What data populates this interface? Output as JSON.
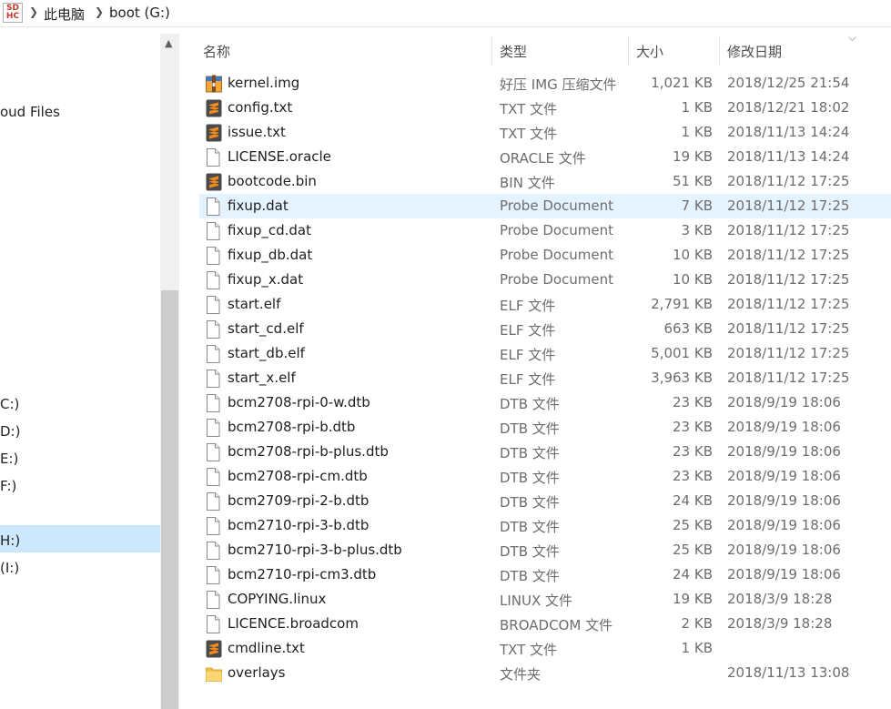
{
  "address_bar": {
    "drive_icon_text_top": "SD",
    "drive_icon_text_bottom": "HC",
    "crumbs": [
      "此电脑",
      "boot (G:)"
    ]
  },
  "nav": {
    "items": [
      "oud Files",
      "C:)",
      "D:)",
      "E:)",
      "F:)",
      "H:)",
      "(I:)"
    ]
  },
  "columns": {
    "name": "名称",
    "type": "类型",
    "size": "大小",
    "date": "修改日期"
  },
  "files": [
    {
      "name": "kernel.img",
      "type": "好压 IMG 压缩文件",
      "size": "1,021 KB",
      "date": "2018/12/25 21:54",
      "icon": "archive-icon"
    },
    {
      "name": "config.txt",
      "type": "TXT 文件",
      "size": "1 KB",
      "date": "2018/12/21 18:02",
      "icon": "sublime-icon"
    },
    {
      "name": "issue.txt",
      "type": "TXT 文件",
      "size": "1 KB",
      "date": "2018/11/13 14:24",
      "icon": "sublime-icon"
    },
    {
      "name": "LICENSE.oracle",
      "type": "ORACLE 文件",
      "size": "19 KB",
      "date": "2018/11/13 14:24",
      "icon": "file-icon"
    },
    {
      "name": "bootcode.bin",
      "type": "BIN 文件",
      "size": "51 KB",
      "date": "2018/11/12 17:25",
      "icon": "sublime-icon"
    },
    {
      "name": "fixup.dat",
      "type": "Probe Document",
      "size": "7 KB",
      "date": "2018/11/12 17:25",
      "icon": "file-icon"
    },
    {
      "name": "fixup_cd.dat",
      "type": "Probe Document",
      "size": "3 KB",
      "date": "2018/11/12 17:25",
      "icon": "file-icon"
    },
    {
      "name": "fixup_db.dat",
      "type": "Probe Document",
      "size": "10 KB",
      "date": "2018/11/12 17:25",
      "icon": "file-icon"
    },
    {
      "name": "fixup_x.dat",
      "type": "Probe Document",
      "size": "10 KB",
      "date": "2018/11/12 17:25",
      "icon": "file-icon"
    },
    {
      "name": "start.elf",
      "type": "ELF 文件",
      "size": "2,791 KB",
      "date": "2018/11/12 17:25",
      "icon": "file-icon"
    },
    {
      "name": "start_cd.elf",
      "type": "ELF 文件",
      "size": "663 KB",
      "date": "2018/11/12 17:25",
      "icon": "file-icon"
    },
    {
      "name": "start_db.elf",
      "type": "ELF 文件",
      "size": "5,001 KB",
      "date": "2018/11/12 17:25",
      "icon": "file-icon"
    },
    {
      "name": "start_x.elf",
      "type": "ELF 文件",
      "size": "3,963 KB",
      "date": "2018/11/12 17:25",
      "icon": "file-icon"
    },
    {
      "name": "bcm2708-rpi-0-w.dtb",
      "type": "DTB 文件",
      "size": "23 KB",
      "date": "2018/9/19 18:06",
      "icon": "file-icon"
    },
    {
      "name": "bcm2708-rpi-b.dtb",
      "type": "DTB 文件",
      "size": "23 KB",
      "date": "2018/9/19 18:06",
      "icon": "file-icon"
    },
    {
      "name": "bcm2708-rpi-b-plus.dtb",
      "type": "DTB 文件",
      "size": "23 KB",
      "date": "2018/9/19 18:06",
      "icon": "file-icon"
    },
    {
      "name": "bcm2708-rpi-cm.dtb",
      "type": "DTB 文件",
      "size": "23 KB",
      "date": "2018/9/19 18:06",
      "icon": "file-icon"
    },
    {
      "name": "bcm2709-rpi-2-b.dtb",
      "type": "DTB 文件",
      "size": "24 KB",
      "date": "2018/9/19 18:06",
      "icon": "file-icon"
    },
    {
      "name": "bcm2710-rpi-3-b.dtb",
      "type": "DTB 文件",
      "size": "25 KB",
      "date": "2018/9/19 18:06",
      "icon": "file-icon"
    },
    {
      "name": "bcm2710-rpi-3-b-plus.dtb",
      "type": "DTB 文件",
      "size": "25 KB",
      "date": "2018/9/19 18:06",
      "icon": "file-icon"
    },
    {
      "name": "bcm2710-rpi-cm3.dtb",
      "type": "DTB 文件",
      "size": "24 KB",
      "date": "2018/9/19 18:06",
      "icon": "file-icon"
    },
    {
      "name": "COPYING.linux",
      "type": "LINUX 文件",
      "size": "19 KB",
      "date": "2018/3/9 18:28",
      "icon": "file-icon"
    },
    {
      "name": "LICENCE.broadcom",
      "type": "BROADCOM 文件",
      "size": "2 KB",
      "date": "2018/3/9 18:28",
      "icon": "file-icon"
    },
    {
      "name": "cmdline.txt",
      "type": "TXT 文件",
      "size": "1 KB",
      "date": "",
      "icon": "sublime-icon"
    },
    {
      "name": "overlays",
      "type": "文件夹",
      "size": "",
      "date": "2018/11/13 13:08",
      "icon": "folder-icon"
    }
  ],
  "hovered_row": "fixup.dat",
  "colors": {
    "hover": "#e5f3ff",
    "selected_nav": "#cce8ff",
    "sublime": "#f28b1e",
    "folder": "#f2c14e"
  }
}
